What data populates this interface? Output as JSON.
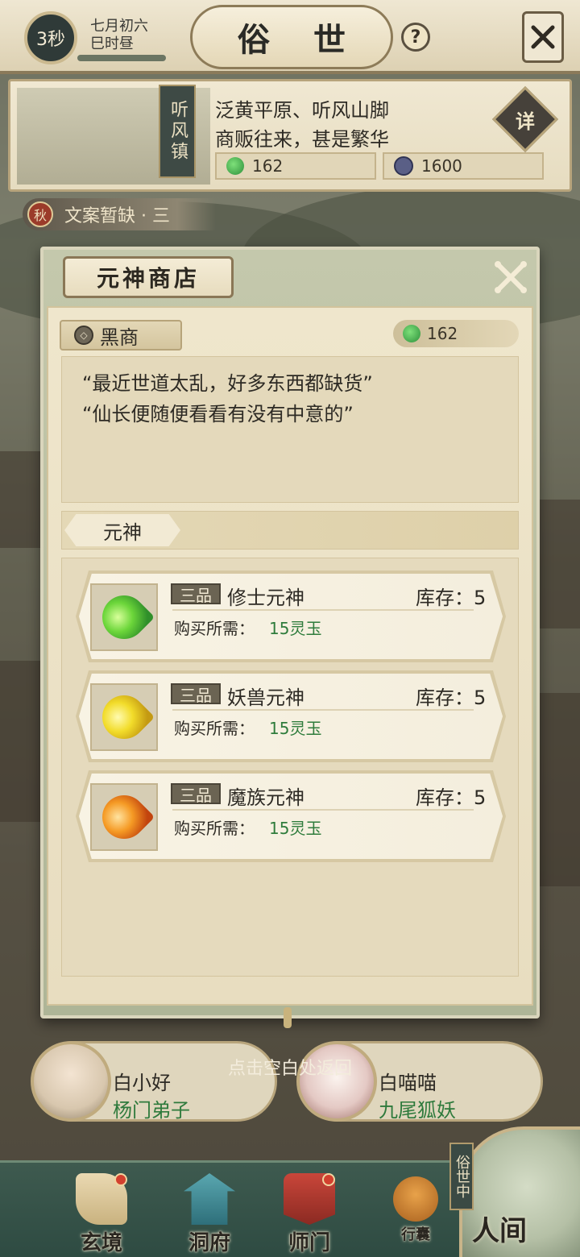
{
  "header": {
    "timer": "3秒",
    "date_line1": "七月初六",
    "date_line2": "巳时昼",
    "title": "俗 世",
    "help": "?"
  },
  "location": {
    "tag": "听风镇",
    "desc_line1": "泛黄平原、听风山脚",
    "desc_line2": "商贩往来，甚是繁华",
    "jade": "162",
    "coins": "1600",
    "detail_label": "详"
  },
  "quest": {
    "icon_label": "秋",
    "text": "文案暂缺 · 三"
  },
  "modal": {
    "title": "元神商店",
    "merchant": "黑商",
    "jade_balance": "162",
    "dialog_line1": "“最近世道太乱，好多东西都缺货”",
    "dialog_line2": "“仙长便随便看看有没有中意的”",
    "category_tab": "元神",
    "items": [
      {
        "grade": "三品",
        "name": "修士元神",
        "stock": "库存：5",
        "price_label": "购买所需：",
        "price": "15灵玉",
        "color": "#4fc33a"
      },
      {
        "grade": "三品",
        "name": "妖兽元神",
        "stock": "库存：5",
        "price_label": "购买所需：",
        "price": "15灵玉",
        "color": "#e5c21c"
      },
      {
        "grade": "三品",
        "name": "魔族元神",
        "stock": "库存：5",
        "price_label": "购买所需：",
        "price": "15灵玉",
        "color": "#ee7a1a"
      }
    ]
  },
  "hint": "点击空白处返回",
  "characters": [
    {
      "name": "白小好",
      "role": "杨门弟子"
    },
    {
      "name": "白喵喵",
      "role": "九尾狐妖"
    }
  ],
  "nav": {
    "items": [
      {
        "label": "玄境",
        "icon": "scroll-icon"
      },
      {
        "label": "洞府",
        "icon": "pavilion-icon"
      },
      {
        "label": "师门",
        "icon": "banner-icon"
      },
      {
        "label": "行囊",
        "icon": "bag-icon"
      }
    ],
    "world_tag": "俗世中",
    "world_label": "人间"
  },
  "colors": {
    "green_text": "#2f7c3c",
    "accent_dark": "#3e4a45"
  }
}
